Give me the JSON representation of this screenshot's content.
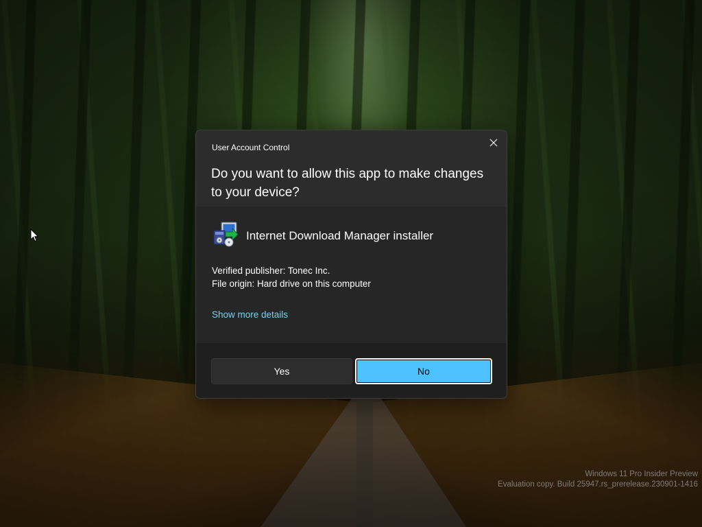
{
  "dialog": {
    "title": "User Account Control",
    "question": "Do you want to allow this app to make changes to your device?",
    "app": {
      "name": "Internet Download Manager installer",
      "icon": "idm-installer-icon"
    },
    "publisher": "Verified publisher: Tonec Inc.",
    "origin": "File origin: Hard drive on this computer",
    "details_link": "Show more details",
    "buttons": {
      "yes": "Yes",
      "no": "No"
    },
    "close_icon": "close-icon"
  },
  "watermark": {
    "line1": "Windows 11 Pro Insider Preview",
    "line2": "Evaluation copy. Build 25947.rs_prerelease.230901-1416"
  },
  "colors": {
    "accent": "#4cc2ff",
    "link": "#79d0e8",
    "dialog_bg": "#2b2b2b",
    "footer_bg": "#1f1f1f"
  }
}
